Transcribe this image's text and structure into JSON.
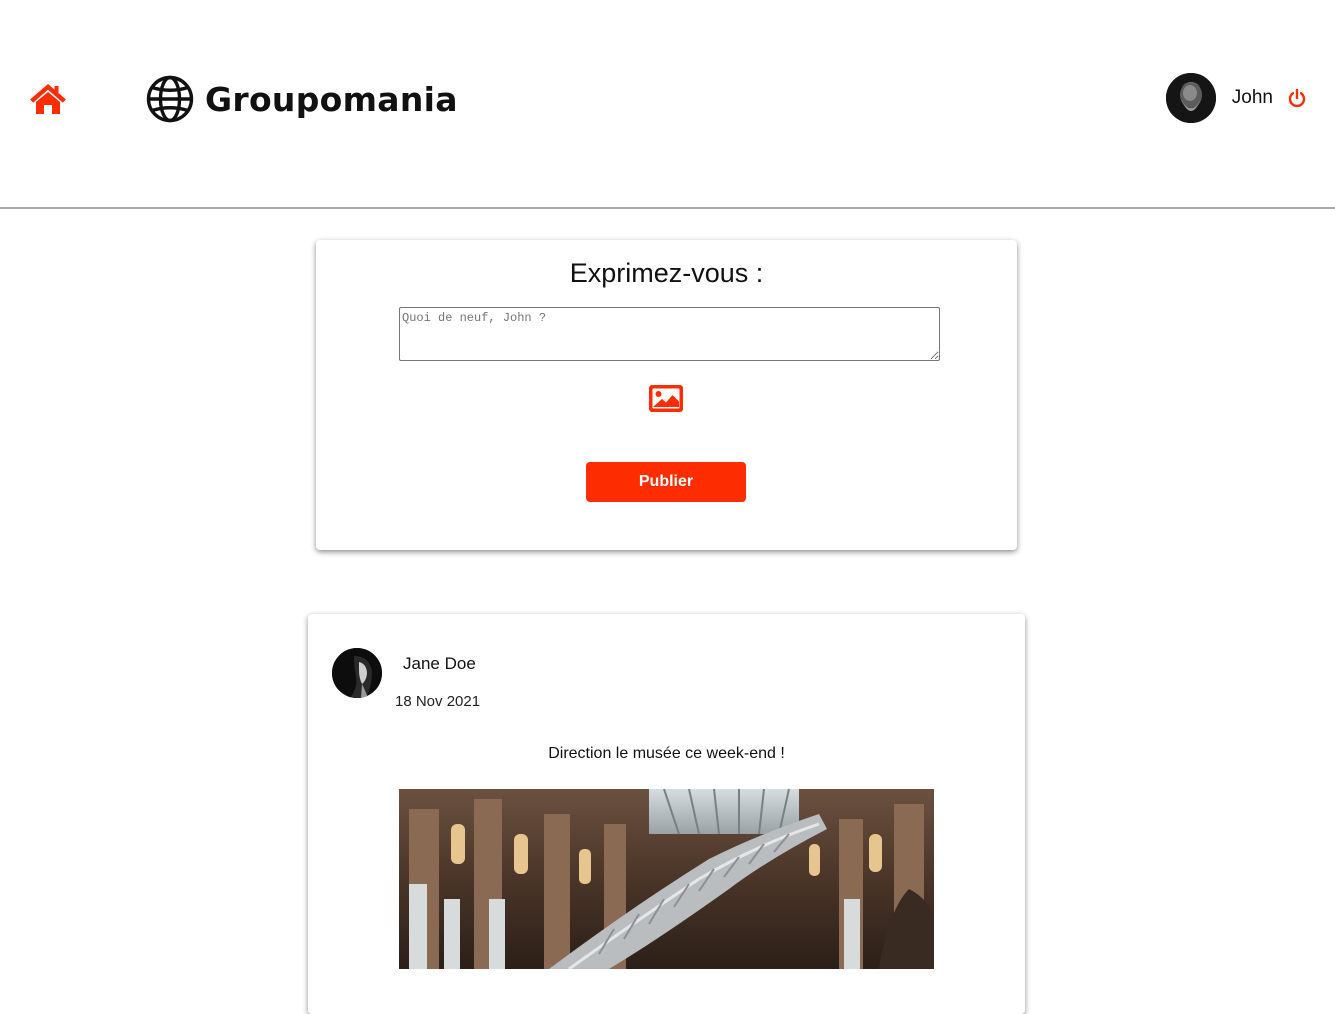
{
  "header": {
    "brand_name": "Groupomania",
    "user_name": "John"
  },
  "composer": {
    "title": "Exprimez-vous :",
    "placeholder": "Quoi de neuf, John ?",
    "publish_label": "Publier"
  },
  "posts": [
    {
      "author": "Jane Doe",
      "date": "18 Nov 2021",
      "text": "Direction le musée ce week-end !"
    }
  ],
  "icons": {
    "home": "home-icon",
    "brand": "globe-icon",
    "logout": "power-icon",
    "image_upload": "image-icon"
  },
  "colors": {
    "accent": "#fd2d01",
    "text": "#111111",
    "divider": "#a9a9a9"
  }
}
